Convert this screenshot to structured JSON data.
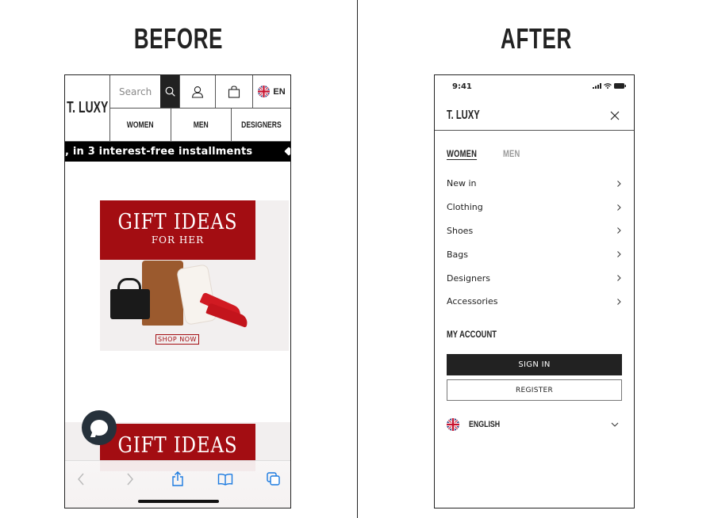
{
  "labels": {
    "before": "BEFORE",
    "after": "AFTER"
  },
  "before": {
    "logo": "T. LUXY",
    "search_placeholder": "Search",
    "language_code": "EN",
    "nav": [
      "WOMEN",
      "MEN",
      "DESIGNERS"
    ],
    "promo_text": ", in 3 interest-free installments",
    "banner": {
      "title": "GIFT IDEAS",
      "subtitle": "FOR HER",
      "cta": "SHOP NOW"
    },
    "banner2": {
      "title": "GIFT IDEAS"
    },
    "icons": {
      "search": "search-icon",
      "account": "user-icon",
      "bag": "shopping-bag-icon",
      "flag": "uk-flag-icon",
      "chat": "chat-icon",
      "back": "chevron-left-icon",
      "forward": "chevron-right-icon",
      "share": "share-icon",
      "bookmarks": "book-icon",
      "tabs": "tabs-icon"
    }
  },
  "after": {
    "status_time": "9:41",
    "logo": "T. LUXY",
    "tabs": [
      {
        "label": "WOMEN",
        "active": true
      },
      {
        "label": "MEN",
        "active": false
      }
    ],
    "menu_items": [
      "New in",
      "Clothing",
      "Shoes",
      "Bags",
      "Designers",
      "Accessories"
    ],
    "account_title": "MY ACCOUNT",
    "sign_in": "SIGN IN",
    "register": "REGISTER",
    "language": "ENGLISH"
  },
  "colors": {
    "brand_dark": "#222222",
    "banner_red": "#a30d12",
    "ios_blue": "#1a7ae0"
  }
}
